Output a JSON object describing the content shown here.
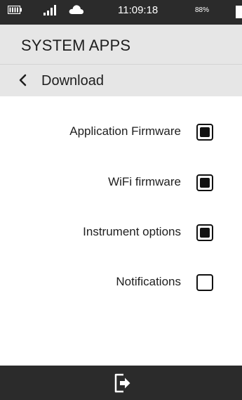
{
  "status_bar": {
    "time": "11:09:18",
    "battery_percent": "88%",
    "icons": [
      "battery-icon",
      "signal-icon",
      "cloud-icon"
    ]
  },
  "header": {
    "title": "SYSTEM APPS"
  },
  "nav": {
    "back_icon": "chevron-left-icon",
    "title": "Download"
  },
  "options": [
    {
      "label": "Application Firmware",
      "checked": true
    },
    {
      "label": "WiFi firmware",
      "checked": true
    },
    {
      "label": "Instrument options",
      "checked": true
    },
    {
      "label": "Notifications",
      "checked": false
    }
  ],
  "bottom_bar": {
    "exit_icon": "exit-icon"
  },
  "colors": {
    "status_bar_bg": "#2b2b2b",
    "header_bg": "#e6e6e6",
    "checkbox": "#111111",
    "bottom_bar_bg": "#2b2b2b"
  }
}
